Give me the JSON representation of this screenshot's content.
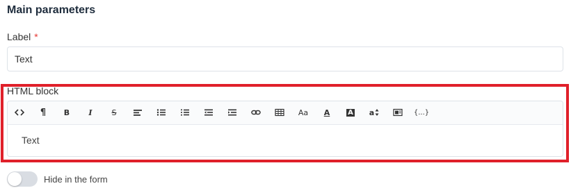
{
  "section": {
    "title": "Main parameters"
  },
  "label_field": {
    "label": "Label",
    "required_mark": "*",
    "value": "Text"
  },
  "html_block": {
    "label": "HTML block",
    "content": "Text",
    "toolbar": {
      "code_view": "code-view-icon",
      "paragraph": "¶",
      "bold": "B",
      "italic": "I",
      "strikethrough": "S",
      "align": "align-left-icon",
      "bullet_list": "bullet-list-icon",
      "numbered_list": "numbered-list-icon",
      "outdent": "outdent-icon",
      "indent": "indent-icon",
      "link": "link-icon",
      "table": "table-icon",
      "font_size": "Aa",
      "font_color": "A",
      "highlight_color": "A",
      "line_height": "a",
      "image": "image-icon",
      "variables": "{...}"
    }
  },
  "toggle": {
    "label": "Hide in the form",
    "checked": false
  },
  "colors": {
    "highlight_border": "#e0202a",
    "required": "#e53935",
    "title": "#1f2d3d"
  }
}
